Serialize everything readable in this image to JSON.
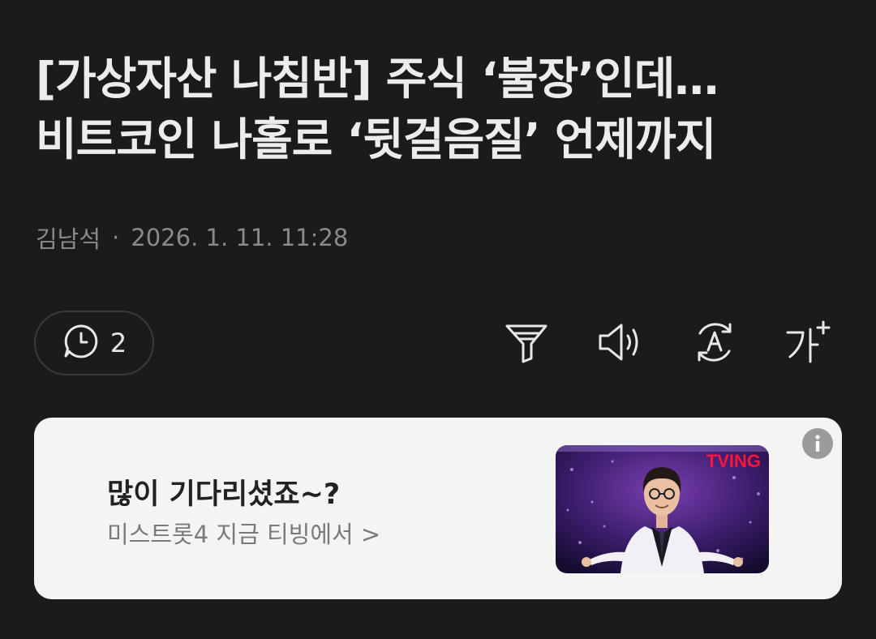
{
  "article": {
    "title_line1": "[가상자산 나침반] 주식 ‘불장’인데…",
    "title_line2": "비트코인 나홀로 ‘뒷걸음질’ 언제까지",
    "author": "김남석",
    "separator": "·",
    "timestamp": "2026. 1. 11. 11:28"
  },
  "toolbar": {
    "comment_count": "2",
    "icons": [
      "comment-clock-icon",
      "summary-funnel-icon",
      "speaker-icon",
      "translate-icon",
      "font-size-icon"
    ],
    "font_size_glyph": "가"
  },
  "ad": {
    "headline": "많이 기다리셨죠~?",
    "subtext": "미스트롯4 지금 티빙에서 >",
    "brand_logo": "TVING",
    "brand_color": "#ff153c",
    "info_icon": "info-icon"
  },
  "colors": {
    "background": "#1b1b1d",
    "card": "#f4f4f4"
  }
}
